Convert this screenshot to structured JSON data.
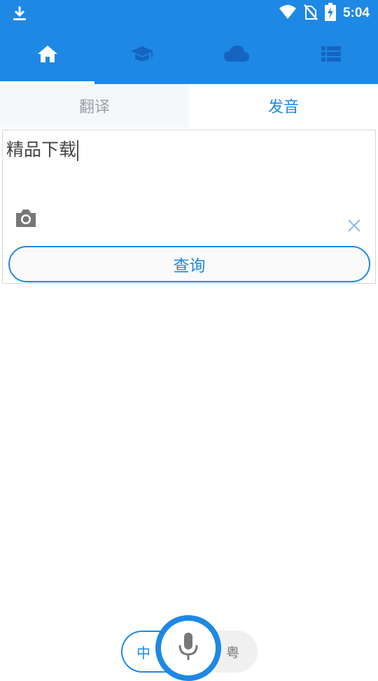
{
  "status_bar": {
    "time": "5:04",
    "icons": [
      "download-icon",
      "wifi-icon",
      "no-sim-icon",
      "battery-charging-icon"
    ]
  },
  "nav": {
    "items": [
      {
        "icon": "home-icon",
        "active": true
      },
      {
        "icon": "graduation-cap-icon",
        "active": false
      },
      {
        "icon": "cloud-icon",
        "active": false
      },
      {
        "icon": "list-icon",
        "active": false
      }
    ]
  },
  "tabs": {
    "translate_label": "翻译",
    "pronounce_label": "发音",
    "active": "发音"
  },
  "input": {
    "value": "精品下载"
  },
  "query_button": {
    "label": "查询"
  },
  "language": {
    "mandarin_label": "中",
    "cantonese_label": "粤",
    "selected": "中"
  },
  "colors": {
    "primary": "#1e88e5",
    "inactive_tab_text": "#9aa0a6",
    "background": "#ffffff"
  }
}
